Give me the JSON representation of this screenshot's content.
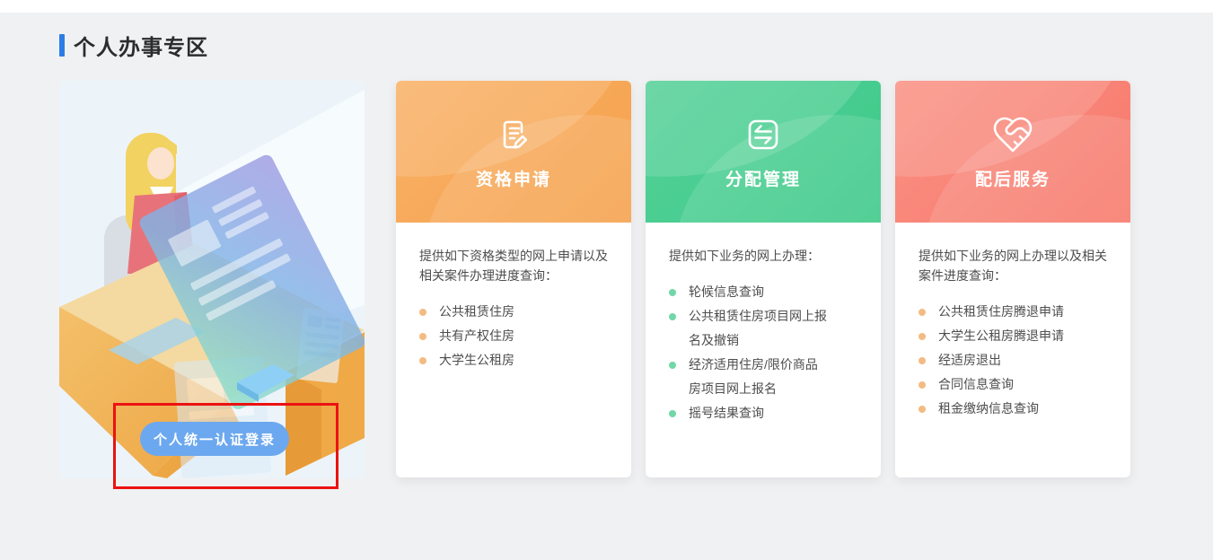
{
  "page": {
    "title": "个人办事专区",
    "accent_bar_color": "#2c7de8",
    "background_color": "#f0f1f2"
  },
  "login_card": {
    "illustration": "woman-at-service-desk-with-monitor",
    "button_label": "个人统一认证登录",
    "button_color": "#6ca8ef",
    "annotation_color": "#ec1212"
  },
  "service_cards": [
    {
      "title": "资格申请",
      "icon": "document-pencil-icon",
      "header_color": "#f6a855",
      "bullet_color": "#f3bb82",
      "intro": "提供如下资格类型的网上申请以及相关案件办理进度查询：",
      "items": [
        "公共租赁住房",
        "共有产权住房",
        "大学生公租房"
      ]
    },
    {
      "title": "分配管理",
      "icon": "transfer-arrows-icon",
      "header_color": "#41d092",
      "bullet_color": "#72d7a6",
      "intro": "提供如下业务的网上办理：",
      "items": [
        "轮候信息查询",
        "公共租赁住房项目网上报名及撤销",
        "经济适用住房/限价商品房项目网上报名",
        "摇号结果查询"
      ]
    },
    {
      "title": "配后服务",
      "icon": "heart-handshake-icon",
      "header_color": "#fa8576",
      "bullet_color": "#f3bb82",
      "intro": "提供如下业务的网上办理以及相关案件进度查询：",
      "items": [
        "公共租赁住房腾退申请",
        "大学生公租房腾退申请",
        "经适房退出",
        "合同信息查询",
        "租金缴纳信息查询"
      ]
    }
  ]
}
